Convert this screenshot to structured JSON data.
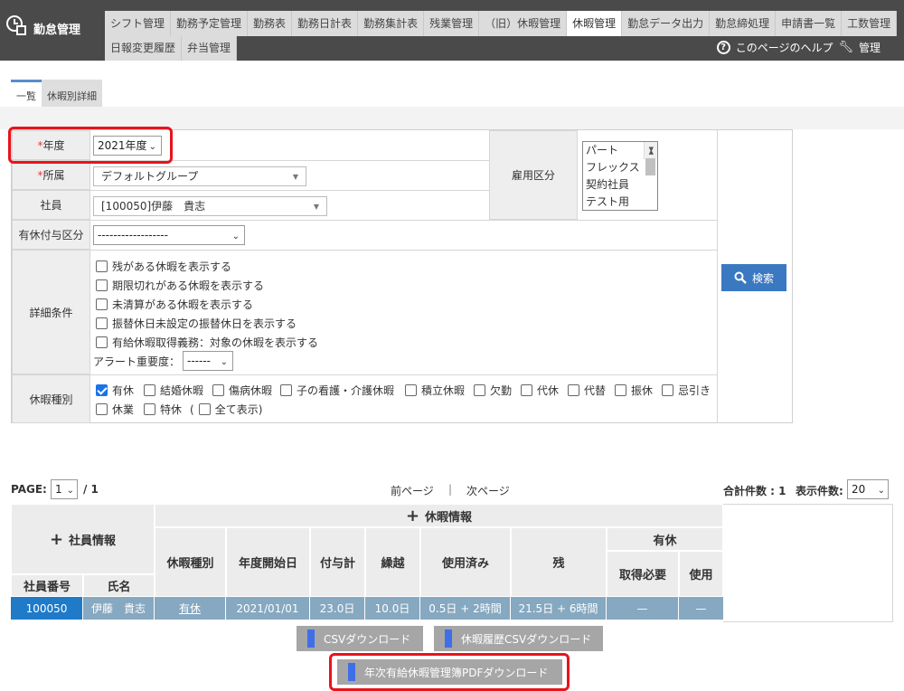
{
  "header": {
    "brand": "勤怠管理",
    "nav_row1": [
      "シフト管理",
      "勤務予定管理",
      "勤務表",
      "勤務日計表",
      "勤務集計表",
      "残業管理",
      "（旧）休暇管理",
      "休暇管理",
      "勤怠データ出力",
      "勤怠締処理",
      "申請書一覧",
      "工数管理"
    ],
    "nav_row2": [
      "日報変更履歴",
      "弁当管理"
    ],
    "active_nav": "休暇管理",
    "help": "このページのヘルプ",
    "admin": "管理"
  },
  "tabs": [
    "一覧",
    "休暇別詳細"
  ],
  "form": {
    "year_label": "年度",
    "year_value": "2021年度",
    "dept_label": "所属",
    "dept_value": "デフォルトグループ",
    "employee_label": "社員",
    "employee_value": "[100050]伊藤　貴志",
    "grant_label": "有休付与区分",
    "grant_value": "------------------",
    "employment_label": "雇用区分",
    "employment_options": [
      "パート",
      "フレックス",
      "契約社員",
      "テスト用"
    ],
    "detail_label": "詳細条件",
    "detail_options": [
      "残がある休暇を表示する",
      "期限切れがある休暇を表示する",
      "未清算がある休暇を表示する",
      "振替休日未設定の振替休日を表示する",
      "有給休暇取得義務：対象の休暇を表示する"
    ],
    "alert_label": "アラート重要度：",
    "alert_value": "------",
    "leave_type_label": "休暇種別",
    "leave_types_row1": [
      "有休",
      "結婚休暇",
      "傷病休暇",
      "子の看護・介護休暇",
      "積立休暇",
      "欠勤",
      "代休",
      "代替",
      "振休",
      "忌引き"
    ],
    "leave_types_row2": [
      "休業",
      "特休"
    ],
    "show_all": "全て表示)",
    "show_all_open": "(",
    "search_button": "検索"
  },
  "pager": {
    "page_label": "PAGE:",
    "page_value": "1",
    "page_total": "/ 1",
    "prev": "前ページ",
    "sep": "|",
    "next": "次ページ",
    "total_label": "合計件数 : 1",
    "per_page_label": "表示件数:",
    "per_page_value": "20"
  },
  "table": {
    "group_employee": "社員情報",
    "group_leave": "休暇情報",
    "col_emp_no": "社員番号",
    "col_name": "氏名",
    "col_type": "休暇種別",
    "col_start": "年度開始日",
    "col_grant": "付与計",
    "col_carry": "繰越",
    "col_used": "使用済み",
    "col_remain": "残",
    "col_paid_group": "有休",
    "col_required": "取得必要",
    "col_use": "使用",
    "row": {
      "emp_no": "100050",
      "name": "伊藤　貴志",
      "type": "有休",
      "start": "2021/01/01",
      "grant": "23.0日",
      "carry": "10.0日",
      "used": "0.5日 + 2時間",
      "remain": "21.5日 + 6時間",
      "required": "—",
      "use": "—"
    }
  },
  "buttons": {
    "csv": "CSVダウンロード",
    "history_csv": "休暇履歴CSVダウンロード",
    "pdf": "年次有給休暇管理簿PDFダウンロード"
  }
}
